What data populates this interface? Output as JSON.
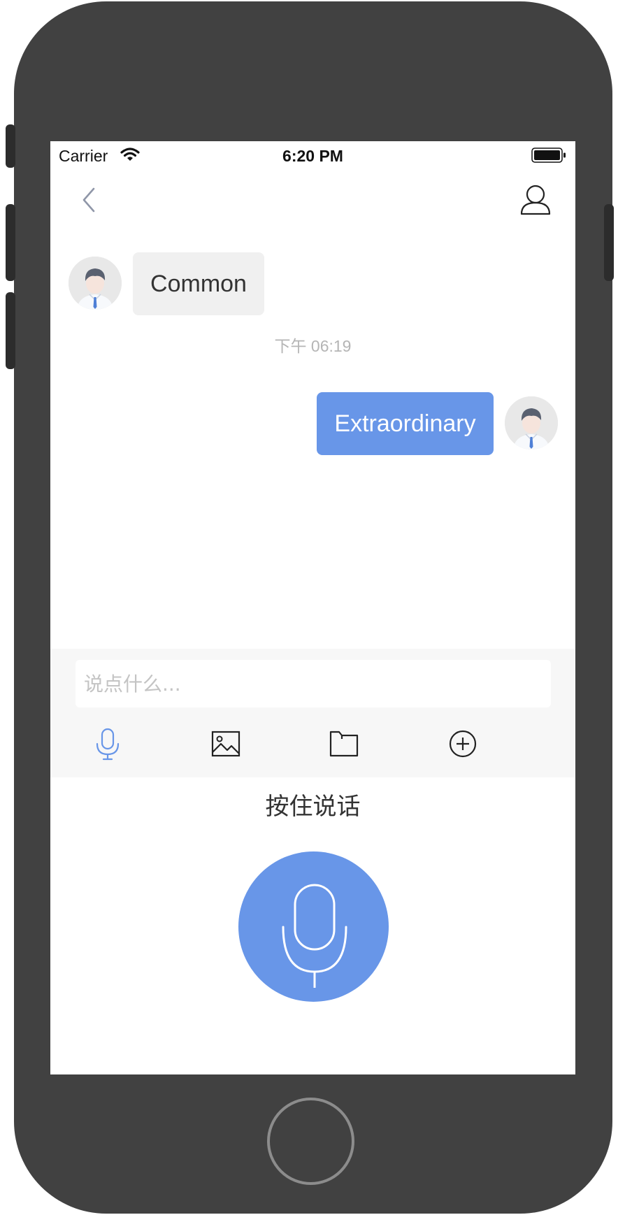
{
  "status_bar": {
    "carrier": "Carrier",
    "time": "6:20 PM",
    "wifi_icon": "wifi-icon",
    "battery_icon": "battery-icon"
  },
  "nav_bar": {
    "back_icon": "chevron-left-icon",
    "profile_icon": "user-icon"
  },
  "conversation": {
    "messages": [
      {
        "direction": "incoming",
        "text": "Common"
      },
      {
        "direction": "outgoing",
        "text": "Extraordinary"
      }
    ],
    "timestamp": "下午 06:19"
  },
  "composer": {
    "placeholder": "说点什么...",
    "value": "",
    "tools": [
      {
        "name": "voice",
        "icon": "microphone-icon",
        "active": true
      },
      {
        "name": "image",
        "icon": "image-icon",
        "active": false
      },
      {
        "name": "file",
        "icon": "folder-icon",
        "active": false
      },
      {
        "name": "more",
        "icon": "plus-circle-icon",
        "active": false
      }
    ]
  },
  "voice_panel": {
    "hint": "按住说话",
    "record_icon": "microphone-icon"
  },
  "colors": {
    "accent": "#6896e8",
    "incoming_bubble": "#f0f0f0",
    "timestamp": "#b5b5b5",
    "frame": "#414141",
    "composer_bg": "#f7f7f7"
  }
}
